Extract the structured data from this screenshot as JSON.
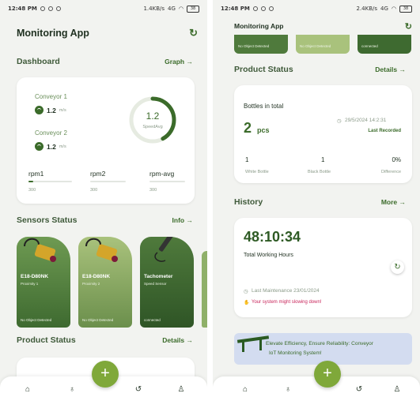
{
  "status_bar": {
    "time": "12:48 PM",
    "net_left": "1.4KB/s",
    "net_right": "2.4KB/s",
    "signal": "4G",
    "battery": "38"
  },
  "app": {
    "title": "Monitoring App",
    "refresh_icon": "refresh-icon"
  },
  "dashboard": {
    "title": "Dashboard",
    "link": "Graph →",
    "conveyor1": {
      "label": "Conveyor 1",
      "value": "1.2",
      "unit": "m/s"
    },
    "conveyor2": {
      "label": "Conveyor 2",
      "value": "1.2",
      "unit": "m/s"
    },
    "gauge": {
      "value": "1.2",
      "label": "SpeedAvg",
      "fraction": 0.42
    },
    "rpm": [
      {
        "label": "rpm1",
        "sub": "300",
        "fraction": 0.1
      },
      {
        "label": "rpm2",
        "sub": "300",
        "fraction": 0.0
      },
      {
        "label": "rpm-avg",
        "sub": "300",
        "fraction": 0.0
      }
    ]
  },
  "sensors": {
    "title": "Sensors Status",
    "link": "Info →",
    "items": [
      {
        "name": "E18-D80NK",
        "sub": "Proximity 1",
        "status": "No Object Detected"
      },
      {
        "name": "E18-D80NK",
        "sub": "Proximity 2",
        "status": "No Object Detected"
      },
      {
        "name": "Tachometer",
        "sub": "Speed Sensor",
        "status": "connected"
      }
    ]
  },
  "product_status": {
    "title": "Product Status",
    "link": "Details →",
    "card_title": "Bottles in total",
    "count": "2",
    "count_unit": "pcs",
    "date": "29/5/2024 14:2:31",
    "last_recorded": "Last Recorded",
    "white": {
      "value": "1",
      "label": "White Bottle"
    },
    "black": {
      "value": "1",
      "label": "Black Bottle"
    },
    "diff": {
      "value": "0%",
      "label": "Difference"
    }
  },
  "history": {
    "title": "History",
    "link": "More →",
    "time": "48:10:34",
    "time_label": "Total Working Hours",
    "maintenance": "Last Maintenance 23/01/2024",
    "warning": "Your system might slowing down!"
  },
  "banner": {
    "line1": "Elevate Efficiency, Ensure Reliability: Conveyor",
    "line2": "IoT Monitoring System!"
  },
  "partial_sensor_status": [
    "No Object Detected",
    "No Object Detected",
    "connected"
  ],
  "nav": {
    "fab": "+"
  },
  "colors": {
    "accent": "#3b6b2a",
    "fab": "#7fa83a",
    "banner_bg": "#d3dcf0"
  }
}
